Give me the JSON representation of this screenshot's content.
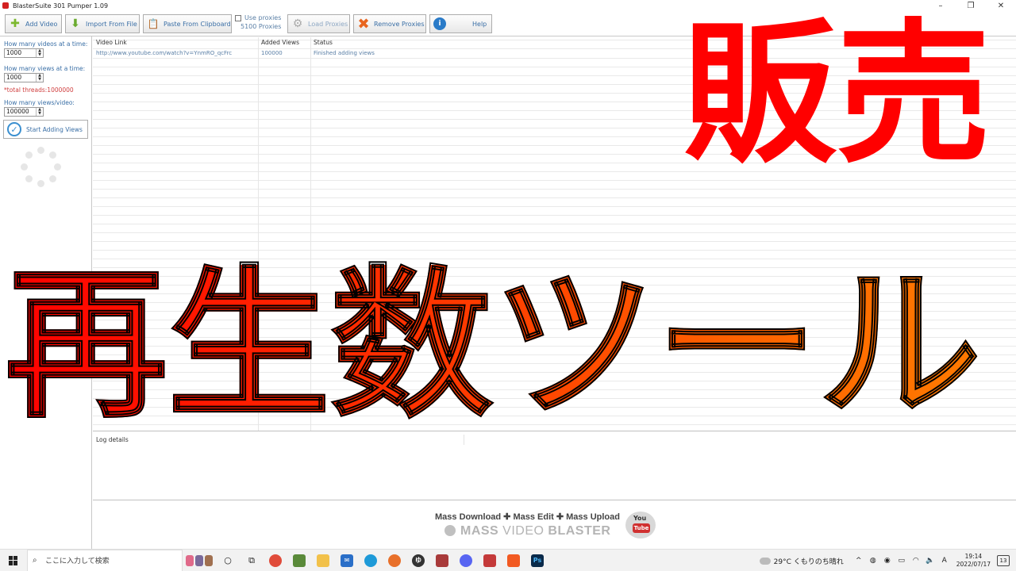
{
  "window": {
    "title": "BlasterSuite 301 Pumper 1.09"
  },
  "toolbar": {
    "add_video": "Add Video",
    "import_file": "Import From File",
    "paste_clipboard": "Paste From Clipboard",
    "use_proxies": "Use proxies",
    "proxy_count": "5100 Proxies",
    "load_proxies": "Load Proxies",
    "remove_proxies": "Remove Proxies",
    "help": "Help"
  },
  "settings": {
    "videos_label": "How many videos at a time:",
    "videos_value": "1000",
    "views_label": "How many views at a time:",
    "views_value": "1000",
    "threads_note": "*total threads:1000000",
    "views_per_video_label": "How many views/video:",
    "views_per_video_value": "100000",
    "start_button": "Start Adding Views"
  },
  "grid": {
    "columns": [
      "Video Link",
      "Added Views",
      "Status"
    ],
    "rows": [
      [
        "http://www.youtube.com/watch?v=YnmRO_qcFrc",
        "100000",
        "Finished adding views"
      ]
    ]
  },
  "log": {
    "header": "Log details"
  },
  "banner": {
    "tagline": "Mass Download ✚ Mass Edit ✚ Mass Upload",
    "brand_a": "MASS ",
    "brand_b": "VIDEO ",
    "brand_c": "BLASTER",
    "yt_you": "You",
    "yt_tube": "Tube"
  },
  "overlay": {
    "top_right": "販売",
    "bottom": "再生数ツール"
  },
  "taskbar": {
    "search_placeholder": "ここに入力して検索",
    "weather": "29°C くもりのち晴れ",
    "ime": "A",
    "time": "19:14",
    "date": "2022/07/17",
    "notifications": "13"
  },
  "colors": {
    "overlay_red": "#ff0000",
    "overlay_orange": "#ff7a00",
    "link_blue": "#3a6fa6"
  }
}
